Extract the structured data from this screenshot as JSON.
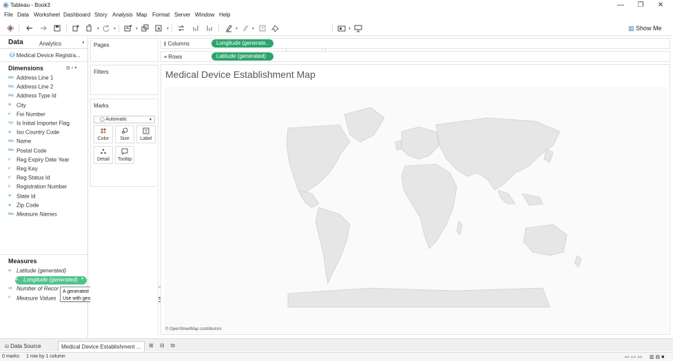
{
  "window": {
    "title": "Tableau - Book3",
    "minimize": "—",
    "restore": "❐",
    "close": "✕"
  },
  "menu": [
    "File",
    "Data",
    "Worksheet",
    "Dashboard",
    "Story",
    "Analysis",
    "Map",
    "Format",
    "Server",
    "Window",
    "Help"
  ],
  "toolbar": {
    "show_me": "Show Me"
  },
  "data_pane": {
    "tab_data": "Data",
    "tab_analytics": "Analytics",
    "datasource": "Medical Device Registra...",
    "dimensions_header": "Dimensions",
    "dimensions": [
      {
        "icon": "Abc",
        "name": "Address Line 1"
      },
      {
        "icon": "Abc",
        "name": "Address Line 2"
      },
      {
        "icon": "Abc",
        "name": "Address Type Id"
      },
      {
        "icon": "⊕",
        "name": "City"
      },
      {
        "icon": "#",
        "name": "Fei Number"
      },
      {
        "icon": "T|F",
        "name": "Is Initial Importer Flag"
      },
      {
        "icon": "⊕",
        "name": "Iso Country Code"
      },
      {
        "icon": "Abc",
        "name": "Name"
      },
      {
        "icon": "Abc",
        "name": "Postal Code"
      },
      {
        "icon": "#",
        "name": "Reg Expiry Date Year"
      },
      {
        "icon": "#",
        "name": "Reg Key"
      },
      {
        "icon": "#",
        "name": "Reg Status Id"
      },
      {
        "icon": "#",
        "name": "Registration Number"
      },
      {
        "icon": "⊕",
        "name": "State Id"
      },
      {
        "icon": "⊕",
        "name": "Zip Code"
      },
      {
        "icon": "Abc",
        "name": "Measure Names"
      }
    ],
    "measures_header": "Measures",
    "measures": [
      {
        "icon": "⊕",
        "name": "Latitude (generated)"
      },
      {
        "icon": "⊕",
        "name": "Longitude (generated)"
      },
      {
        "icon": "=#",
        "name": "Number of Recor"
      },
      {
        "icon": "#",
        "name": "Measure Values"
      }
    ]
  },
  "tooltip": {
    "line1": "A generated field with longitude values.",
    "line2": "Use with geographic dimensions in map views."
  },
  "cards": {
    "pages": "Pages",
    "filters": "Filters",
    "marks": "Marks",
    "mark_type": "Automatic",
    "mark_buttons": {
      "color": "Color",
      "size": "Size",
      "label": "Label",
      "detail": "Detail",
      "tooltip": "Tooltip"
    }
  },
  "shelves": {
    "columns_label": "Columns",
    "columns_pill": "Longitude (generate..",
    "rows_label": "Rows",
    "rows_pill": "Latitude (generated)"
  },
  "viz": {
    "title": "Medical Device Establishment Map",
    "attribution": "© OpenStreetMap contributors"
  },
  "sheets": {
    "data_source": "Data Source",
    "active_sheet": "Medical Device Establishment ..."
  },
  "status": {
    "marks": "0 marks",
    "dims": "1 row by 1 column"
  }
}
